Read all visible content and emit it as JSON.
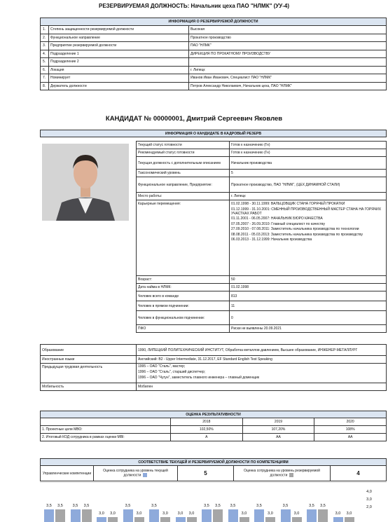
{
  "header": {
    "title": "РЕЗЕРВИРУЕМАЯ ДОЛЖНОСТЬ: Начальник цеха ПАО \"НЛМК\" (УУ-4)"
  },
  "position_info": {
    "section_title": "ИНФОРМАЦИЯ О РЕЗЕРВИРУЕМОЙ ДОЛЖНОСТИ",
    "rows": [
      {
        "n": "1.",
        "label": "Степень защищенности резервируемой должности",
        "value": "Высокая"
      },
      {
        "n": "2.",
        "label": "Функциональное направление",
        "value": "Прокатное производство"
      },
      {
        "n": "3.",
        "label": "Предприятие резервируемой должности",
        "value": "ПАО \"НЛМК\""
      },
      {
        "n": "4.",
        "label": "Подразделение 1",
        "value": "ДИРЕКЦИЯ ПО ПРОКАТНОМУ ПРОИЗВОДСТВУ"
      },
      {
        "n": "5.",
        "label": "Подразделение 2",
        "value": ""
      },
      {
        "n": "6.",
        "label": "Локация",
        "value": "г. Липецк"
      },
      {
        "n": "7.",
        "label": "Номинирует",
        "value": "Иванов Иван Иванович, Специалист ПАО \"НЛМК\""
      },
      {
        "n": "8.",
        "label": "Держатель должности",
        "value": "Петров Александр Николаевич, Начальник цеха, ПАО \"НЛМК\""
      }
    ]
  },
  "candidate": {
    "title": "КАНДИДАТ № 00000001, Дмитрий Сергеевич Яковлев",
    "section_title": "ИНФОРМАЦИЯ О КАНДИДАТЕ В КАДРОВЫЙ РЕЗЕРВ",
    "rows": [
      {
        "label": "Текущий статус готовности",
        "value": "Готов к назначению (Гн)"
      },
      {
        "label": "Рекомендуемый статус готовности",
        "value": "Готов к назначению (Гн)"
      },
      {
        "label": "Текущая должность с дополнительным описанием",
        "value": "Начальник производства"
      },
      {
        "label": "Таксономический уровень",
        "value": "5"
      },
      {
        "label": "Функциональное направление, Предприятие:",
        "value": "Прокатное производство, ПАО \"НЛМК\", (ЦЕХ ДИНАМНОЙ СТАЛИ)"
      },
      {
        "label": "Место работы:",
        "value": "г. Липецк"
      }
    ],
    "career_label": "Карьерные перемещения:",
    "career": [
      "01.02.1998 - 30.11.1999: ВАЛЬЦОВЩИК СТАНА ГОРЯЧЕЙ ПРОКАТКИ",
      "01.12.1999 - 31.10.2001: СМЕННЫЙ ПРОИЗВОДСТВЕННЫЙ МАСТЕР СТАНА НА ГОРЯЧИХ УЧАСТКАХ РАБОТ",
      "01.11.2001 - 06.05.2007: НАЧАЛЬНИК БЮРО КАЧЕСТВА",
      "07.05.2007 - 26.09.2010: Главный специалист по качеству",
      "27.09.2010 - 07.08.2011: Заместитель начальника производства по технологии",
      "08.08.2011 - 05.03.2013: Заместитель начальника производства по производству",
      "06.03.2013 - 31.12.1999: Начальник производства"
    ],
    "rows2": [
      {
        "label": "Возраст:",
        "value": "50"
      },
      {
        "label": "Дата найма в НЛМК:",
        "value": "01.02.1998"
      },
      {
        "label": "Человек всего в команде",
        "value": "813"
      },
      {
        "label": "Человек в прямом подчинении:",
        "value": "11"
      },
      {
        "label": "Человек в функциональном подчинении:",
        "value": "0"
      },
      {
        "label": "ПФО",
        "value": "Риски не выявлены 20.09.2021"
      }
    ],
    "wide_rows": [
      {
        "label": "Образование",
        "value": "1990, ЛИПЕЦКИЙ ПОЛИТЕХНИЧЕСКИЙ ИНСТИТУТ, Обработка металлов давлением, Высшее образование, ИНЖЕНЕР-МЕТАЛЛУРГ"
      },
      {
        "label": "Иностранные языки",
        "value": "Английский: B2 - Upper Intermediate, 31.12.2017, EF Standard English Test Speaking"
      }
    ],
    "prev_label": "Предыдущая трудовая деятельность",
    "prev": [
      "1995 – ОАО \"Сталь\", мастер;",
      "1996 – ОАО \"Сталь\", старший диспетчер;",
      "1996 – ОАО \"Чугун\", заместитель главного инженера – главный доменщик"
    ],
    "mobility_label": "Мобильность",
    "mobility_value": "Мобилен"
  },
  "performance": {
    "section_title": "ОЦЕНКА РЕЗУЛЬТАТИВНОСТИ",
    "years": [
      "2018",
      "2019",
      "2020"
    ],
    "rows": [
      {
        "label": "1. Проектные цели МВО:",
        "values": [
          "102,50%",
          "107,20%",
          "108%"
        ]
      },
      {
        "label": "2. Итоговый КОД сотрудника в рамках оценки MBI:",
        "values": [
          "A",
          "AA",
          "AA"
        ]
      }
    ]
  },
  "competencies": {
    "section_title": "СООТВЕТСТВИЕ ТЕКУЩЕЙ И РЕЗЕРВИРУЕМОЙ ДОЛЖНОСТИ ПО КОМПЕТЕНЦИЯМ",
    "col1": "Управленческие компетенции",
    "col2": "Оценка сотрудника на уровень текущей должности",
    "col2_value": "5",
    "col3": "Оценка сотрудника на уровень резервируемой должности",
    "col3_value": "4",
    "colors": {
      "blue": "#8eaadb",
      "gray": "#a6a6a6"
    }
  },
  "chart_data": {
    "type": "bar",
    "series": [
      {
        "values": [
          3.5,
          3.5,
          3.0,
          3.5,
          3.5,
          3.0,
          3.5,
          3.5,
          3.5,
          3.5,
          3.5,
          3.0
        ]
      },
      {
        "values": [
          3.5,
          3.5,
          3.0,
          3.0,
          3.0,
          3.0,
          3.5,
          3.0,
          3.0,
          3.0,
          3.5,
          3.0
        ]
      }
    ],
    "value_labels": [
      "3,5",
      "3,5",
      "3,5",
      "3,5",
      "3,0",
      "3,0",
      "3,5",
      "3,0",
      "3,5",
      "3,0",
      "3,0",
      "3,0",
      "3,5",
      "3,5",
      "3,5",
      "3,0",
      "3,5",
      "3,0",
      "3,5",
      "3,0",
      "3,5",
      "3,5",
      "3,0",
      "3,0"
    ],
    "ytick_labels": [
      "4,0",
      "3,0",
      "2,0"
    ],
    "ylim": [
      2.0,
      4.0
    ]
  }
}
